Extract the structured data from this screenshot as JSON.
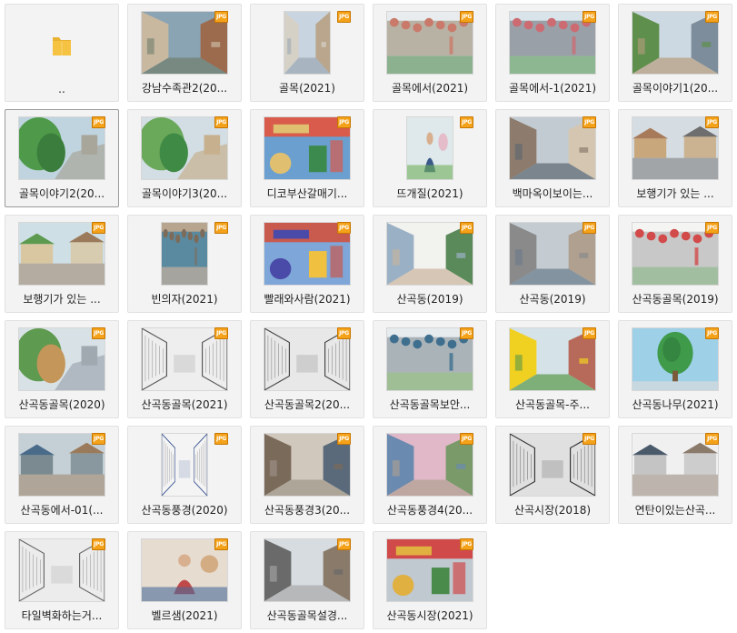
{
  "folder": {
    "label": "..",
    "icon": "folder-icon"
  },
  "badge_text": "JPG",
  "colors": {
    "badge": "#f4a21a",
    "folder": "#f5c242"
  },
  "files": [
    {
      "label": "강남수족관2(20...",
      "scene": "alley",
      "palette": [
        "#8aa4b4",
        "#c9b8a0",
        "#6f7d6a",
        "#9c6b4e"
      ]
    },
    {
      "label": "골목(2021)",
      "scene": "street",
      "palette": [
        "#c8d4e0",
        "#d6d1c7",
        "#9aa7b2",
        "#b9a68c"
      ]
    },
    {
      "label": "골목에서(2021)",
      "scene": "wall",
      "palette": [
        "#e9ecef",
        "#c97a6a",
        "#4e8a4f",
        "#b8b2a5"
      ]
    },
    {
      "label": "골목에서-1(2021)",
      "scene": "wall",
      "palette": [
        "#d8e4ea",
        "#cc6b72",
        "#5c9a55",
        "#9aa0a8"
      ]
    },
    {
      "label": "골목이야기1(20...",
      "scene": "alley",
      "palette": [
        "#cdd9e2",
        "#5f8f4d",
        "#b69c7e",
        "#7d8d9b"
      ]
    },
    {
      "label": "골목이야기2(20...",
      "scene": "green",
      "palette": [
        "#bfd4de",
        "#4f9a4a",
        "#3b7d3c",
        "#a8a69b"
      ]
    },
    {
      "label": "골목이야기3(20...",
      "scene": "green",
      "palette": [
        "#d2dde4",
        "#6aa85a",
        "#3f8a45",
        "#c7b08e"
      ]
    },
    {
      "label": "디코부산갈매기...",
      "scene": "market",
      "palette": [
        "#6a9fd0",
        "#d95b4b",
        "#3d8a4f",
        "#e0c070"
      ]
    },
    {
      "label": "뜨개질(2021)",
      "scene": "person",
      "palette": [
        "#dfe8ea",
        "#3a5a8a",
        "#6fb05a",
        "#e6b0c0"
      ]
    },
    {
      "label": "백마옥이보이는...",
      "scene": "alley",
      "palette": [
        "#c3cbd2",
        "#8d7c6d",
        "#5c6670",
        "#d4c6b0"
      ]
    },
    {
      "label": "보행기가 있는 ...",
      "scene": "houses",
      "palette": [
        "#d6dde2",
        "#a77a5a",
        "#6e6e6e",
        "#c8a77c"
      ]
    },
    {
      "label": "보행기가 있는 ...",
      "scene": "houses",
      "palette": [
        "#cfdfe6",
        "#5b9a4f",
        "#9a7a5a",
        "#d9c7a2"
      ]
    },
    {
      "label": "빈의자(2021)",
      "scene": "wall",
      "palette": [
        "#b7a58f",
        "#7d6b5a",
        "#9aa3a8",
        "#5a8aa0"
      ]
    },
    {
      "label": "빨래와사람(2021)",
      "scene": "market",
      "palette": [
        "#7ea6d8",
        "#c85a4e",
        "#f0c040",
        "#4a4aa8"
      ]
    },
    {
      "label": "산곡동(2019)",
      "scene": "street",
      "palette": [
        "#f2f2ee",
        "#9ab0c4",
        "#c9b49c",
        "#5a8a5a"
      ]
    },
    {
      "label": "산곡동(2019)",
      "scene": "street",
      "palette": [
        "#c4ccd2",
        "#8a8a8a",
        "#6a7a8a",
        "#b0a090"
      ]
    },
    {
      "label": "산곡동골목(2019)",
      "scene": "wall",
      "palette": [
        "#f4f4f2",
        "#d24a4a",
        "#6a9a6a",
        "#c8c8c8"
      ]
    },
    {
      "label": "산곡동골목(2020)",
      "scene": "green",
      "palette": [
        "#d8e2e6",
        "#5e9a4f",
        "#c4965a",
        "#a0a8b0"
      ]
    },
    {
      "label": "산곡동골목(2021)",
      "scene": "sketch",
      "palette": [
        "#eeeeee",
        "#555555",
        "#999999",
        "#cccccc"
      ]
    },
    {
      "label": "산곡동골목2(20...",
      "scene": "sketch",
      "palette": [
        "#e8e8e8",
        "#444444",
        "#8a8a8a",
        "#bdbdbd"
      ]
    },
    {
      "label": "산곡동골목보안...",
      "scene": "wall",
      "palette": [
        "#e6ebee",
        "#3f6f8f",
        "#6fa05a",
        "#a9b3b8"
      ]
    },
    {
      "label": "산곡동골목-주...",
      "scene": "street",
      "palette": [
        "#d5e2e8",
        "#f0d020",
        "#5a9a4a",
        "#b86a5a"
      ]
    },
    {
      "label": "산곡동나무(2021)",
      "scene": "tree",
      "palette": [
        "#9ed0e8",
        "#3f9a4a",
        "#2f7a3a",
        "#c8d8e0"
      ]
    },
    {
      "label": "산곡동에서-01(...",
      "scene": "houses",
      "palette": [
        "#c4d0d6",
        "#4a6a8a",
        "#9a7a5a",
        "#7a8a90"
      ]
    },
    {
      "label": "산곡동풍경(2020)",
      "scene": "sketch",
      "palette": [
        "#f4f4f4",
        "#2f4a8a",
        "#7a7a7a",
        "#c0c8d8"
      ]
    },
    {
      "label": "산곡동풍경3(20...",
      "scene": "alley",
      "palette": [
        "#d0c8bc",
        "#7a6a5a",
        "#a0958a",
        "#5a6a7a"
      ]
    },
    {
      "label": "산곡동풍경4(20...",
      "scene": "street",
      "palette": [
        "#e0b8c8",
        "#6a8ab0",
        "#b0a090",
        "#7a9a6a"
      ]
    },
    {
      "label": "산곡시장(2018)",
      "scene": "sketch",
      "palette": [
        "#e0e0e0",
        "#333333",
        "#777777",
        "#aaaaaa"
      ]
    },
    {
      "label": "연탄이있는산곡...",
      "scene": "houses",
      "palette": [
        "#f0f0f0",
        "#4a5a6a",
        "#8a7a6a",
        "#c4c4c4"
      ]
    },
    {
      "label": "타일벽화하는거...",
      "scene": "sketch",
      "palette": [
        "#ececec",
        "#666666",
        "#9a9a9a",
        "#cfcfcf"
      ]
    },
    {
      "label": "벨르샘(2021)",
      "scene": "person",
      "palette": [
        "#e6dcd0",
        "#c04a4a",
        "#4a6a9a",
        "#d0a070"
      ]
    },
    {
      "label": "산곡동골목설경...",
      "scene": "alley",
      "palette": [
        "#d6dce0",
        "#6a6a6a",
        "#a8a8a8",
        "#8a7a6a"
      ]
    },
    {
      "label": "산곡동시장(2021)",
      "scene": "market",
      "palette": [
        "#c0c8d0",
        "#d04a4a",
        "#4a8a4a",
        "#e0b040"
      ]
    }
  ]
}
